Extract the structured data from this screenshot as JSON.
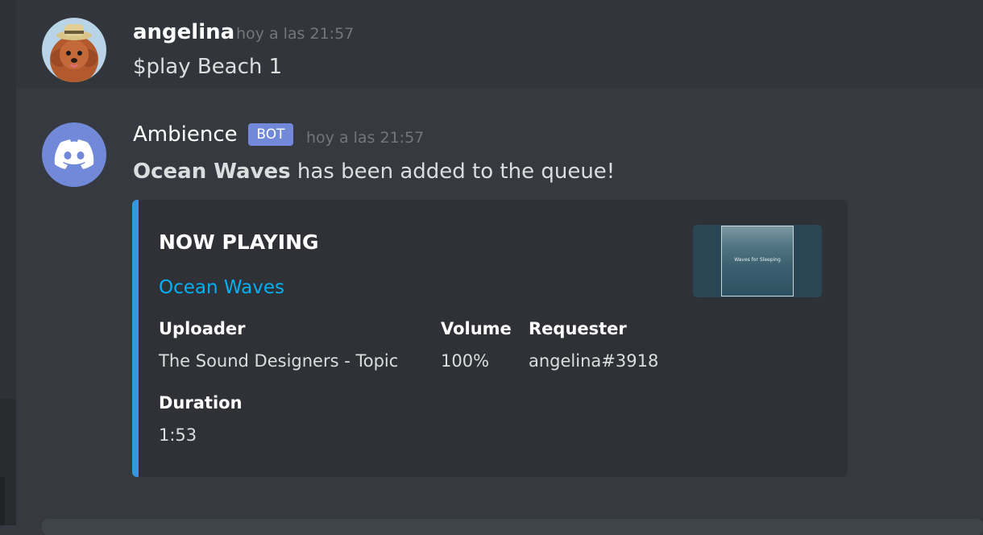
{
  "messages": [
    {
      "username": "angelina",
      "timestamp": "hoy a las 21:57",
      "content": "$play Beach 1"
    },
    {
      "username": "Ambience",
      "badge": "BOT",
      "timestamp": "hoy a las 21:57",
      "content_bold": "Ocean Waves",
      "content_rest": " has been added to the queue!",
      "embed": {
        "title": "NOW PLAYING",
        "link": "Ocean Waves",
        "thumbnail_text": "Waves for Sleeping",
        "fields": [
          {
            "name": "Uploader",
            "value": "The Sound Designers - Topic"
          },
          {
            "name": "Volume",
            "value": "100%"
          },
          {
            "name": "Requester",
            "value": "angelina#3918"
          },
          {
            "name": "Duration",
            "value": "1:53"
          }
        ]
      }
    }
  ],
  "colors": {
    "background": "#36393f",
    "embed_accent": "#3498db",
    "link": "#00b0f4",
    "bot_badge": "#7289da"
  }
}
